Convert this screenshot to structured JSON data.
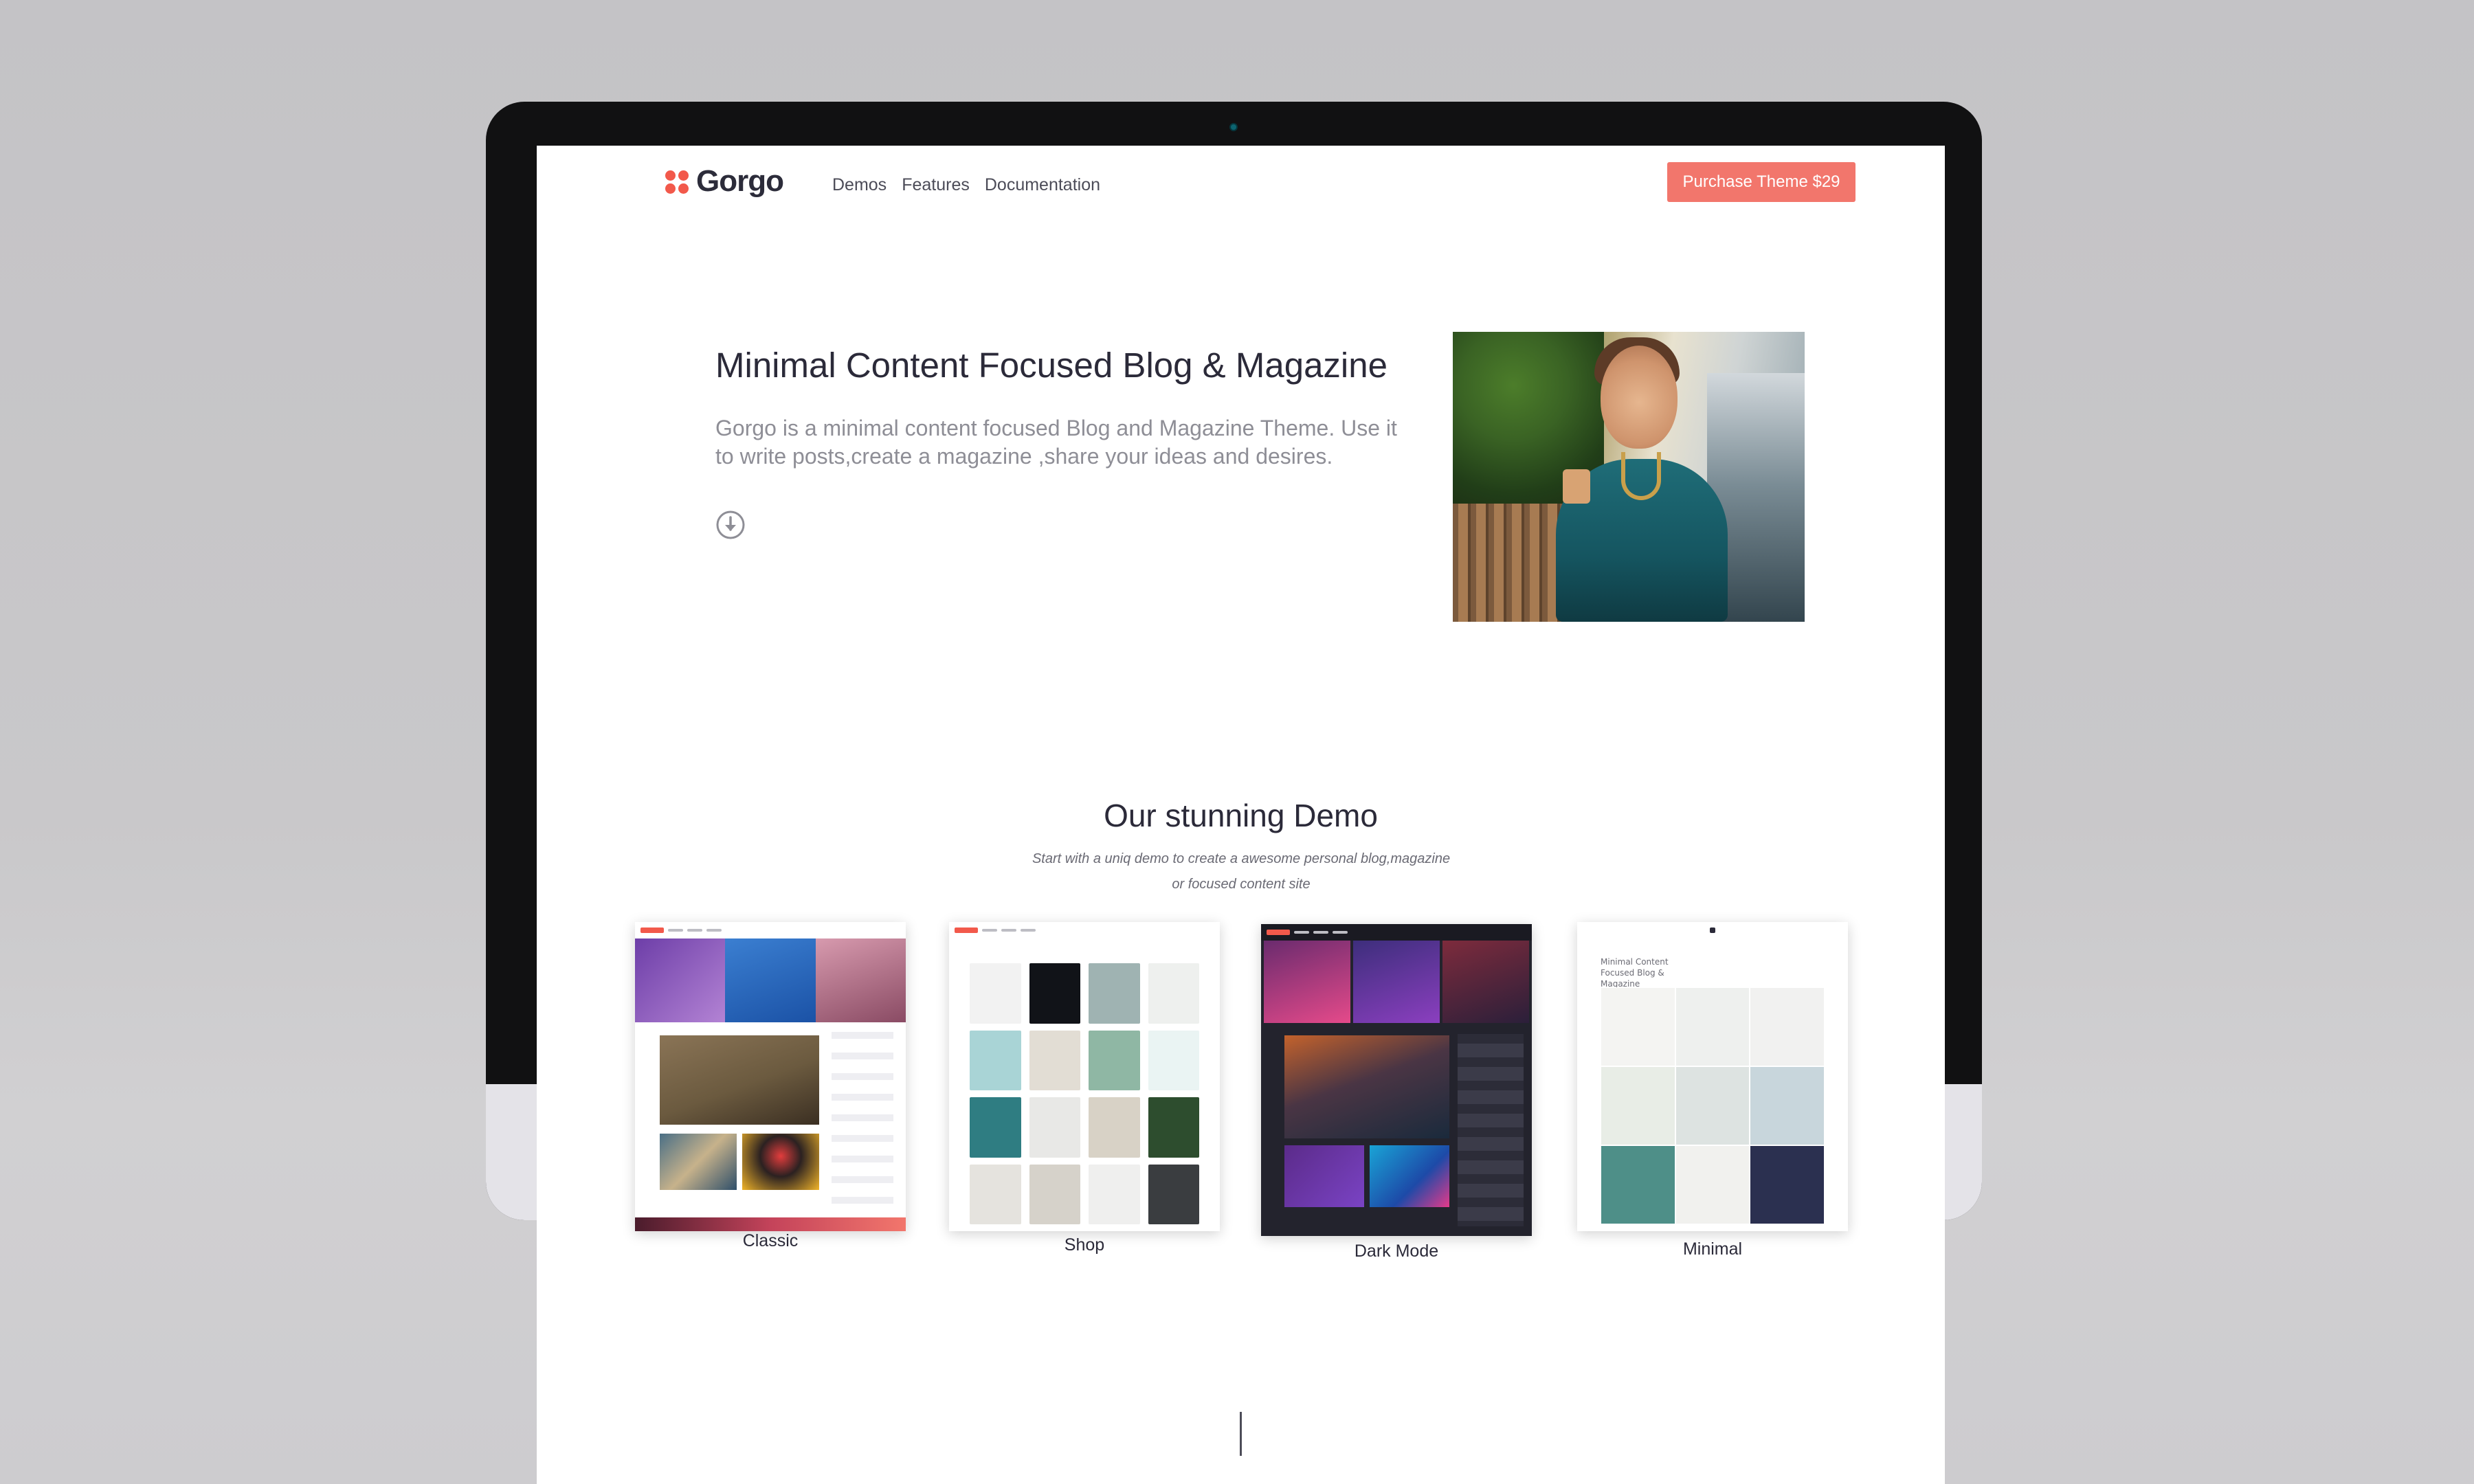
{
  "brand": {
    "name": "Gorgo",
    "accent": "#f2594b",
    "button_color": "#f2766c"
  },
  "nav": {
    "links": [
      "Demos",
      "Features",
      "Documentation"
    ],
    "purchase_label": "Purchase Theme $29"
  },
  "hero": {
    "title": "Minimal Content Focused Blog & Magazine",
    "description": "Gorgo is a minimal content focused Blog and Magazine Theme. Use it to write posts,create a magazine ,share your ideas and desires.",
    "scroll_icon": "arrow-down-circle-icon"
  },
  "demos": {
    "title": "Our stunning Demo",
    "subtitle_line1": "Start with a uniq demo to create a awesome personal blog,magazine",
    "subtitle_line2": "or focused content site",
    "items": [
      {
        "label": "Classic",
        "thumb": "classic"
      },
      {
        "label": "Shop",
        "thumb": "shop"
      },
      {
        "label": "Dark Mode",
        "thumb": "dark"
      },
      {
        "label": "Minimal",
        "thumb": "minimal",
        "mini_title": "Minimal Content Focused Blog & Magazine"
      }
    ]
  }
}
